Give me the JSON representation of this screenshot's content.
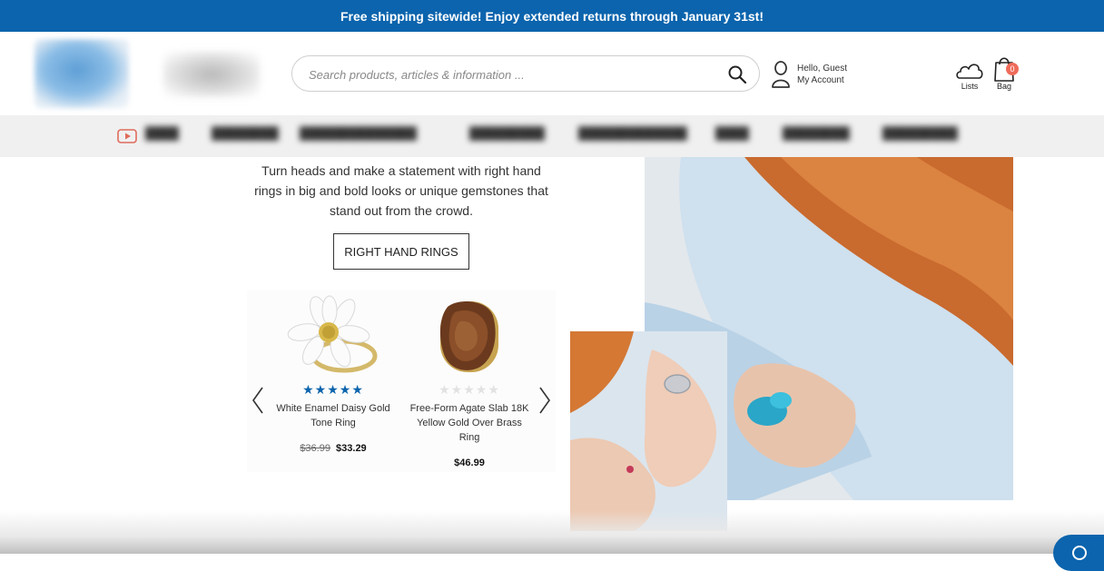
{
  "promo_banner": {
    "text": "Free shipping sitewide! Enjoy extended returns through January 31st!"
  },
  "header": {
    "search": {
      "placeholder": "Search products, articles & information ..."
    },
    "account": {
      "greeting": "Hello, Guest",
      "link": "My Account"
    },
    "lists": {
      "label": "Lists"
    },
    "bag": {
      "label": "Bag",
      "count": "0"
    }
  },
  "nav": {
    "icon": "play-icon",
    "items": [
      "",
      "",
      "",
      "",
      "",
      "",
      "",
      ""
    ]
  },
  "hero": {
    "description": "Turn heads and make a statement with right hand rings in big and bold looks or unique gemstones that stand out from the crowd.",
    "button_label": "RIGHT HAND RINGS"
  },
  "carousel": {
    "products": [
      {
        "name": "White Enamel Daisy Gold Tone Ring",
        "stars": "★★★★★",
        "rating": 5,
        "old_price": "$36.99",
        "price": "$33.29"
      },
      {
        "name": "Free-Form Agate Slab 18K Yellow Gold Over Brass Ring",
        "stars": "★★★★★",
        "rating": 0,
        "price": "$46.99"
      }
    ]
  },
  "colors": {
    "brand": "#0b64ad",
    "badge": "#ef6b5a",
    "star": "#0b64ad"
  }
}
